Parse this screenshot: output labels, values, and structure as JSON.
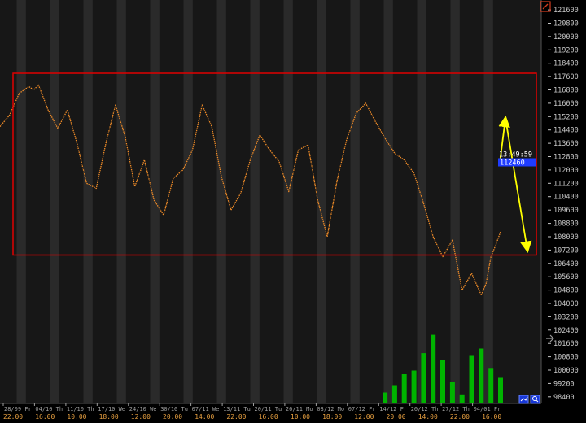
{
  "chart_data": {
    "type": "line",
    "title": "",
    "price_axis": {
      "ticks": [
        "121600",
        "120800",
        "120000",
        "119200",
        "118400",
        "117600",
        "116800",
        "116000",
        "115200",
        "114400",
        "113600",
        "112800",
        "112000",
        "111200",
        "110400",
        "109600",
        "108800",
        "108000",
        "107200",
        "106400",
        "105600",
        "104800",
        "104000",
        "103200",
        "102400",
        "101600",
        "100800",
        "100000",
        "99200",
        "98400"
      ],
      "ylim": [
        98000,
        121800
      ]
    },
    "price_marker": {
      "time": "13:49:59",
      "value": "112460"
    },
    "date_labels": [
      "28/09 Fr",
      "04/10 Th",
      "11/10 Th",
      "17/10 We",
      "24/10 We",
      "30/10 Tu",
      "07/11 We",
      "13/11 Tu",
      "20/11 Tu",
      "26/11 Mo",
      "03/12 Mo",
      "07/12 Fr",
      "14/12 Fr",
      "20/12 Th",
      "27/12 Th",
      "04/01 Fr"
    ],
    "time_labels": [
      "22:00",
      "16:00",
      "10:00",
      "18:00",
      "12:00",
      "20:00",
      "14:00",
      "22:00",
      "16:00",
      "10:00",
      "18:00",
      "12:00",
      "20:00",
      "14:00",
      "22:00",
      "16:00"
    ],
    "series": [
      {
        "color": "#f08c28",
        "x": [
          0,
          2,
          4,
          6,
          7,
          8,
          10,
          12,
          14,
          16,
          18,
          20,
          22,
          24,
          26,
          28,
          30,
          32,
          34,
          36,
          38,
          40,
          42,
          44,
          46,
          48,
          50,
          52,
          54,
          56,
          58,
          60,
          62,
          64,
          66,
          68,
          70,
          72,
          74,
          76,
          78,
          80,
          82,
          84,
          86,
          88,
          90,
          92,
          94,
          96,
          98,
          100
        ],
        "y": [
          114600,
          115300,
          116600,
          117000,
          116800,
          117100,
          115600,
          114500,
          115600,
          113600,
          111200,
          110900,
          113600,
          115900,
          114000,
          111000,
          112600,
          110200,
          109300,
          111500,
          112000,
          113200,
          115900,
          114600,
          111600,
          109600,
          110600,
          112600,
          114100,
          113200,
          112500,
          110700,
          113200,
          113500,
          110200,
          108000,
          111300,
          113800,
          115400,
          116000,
          114900,
          113900,
          113000,
          112600,
          111800,
          110000,
          108000,
          106800,
          107800,
          104800,
          105800,
          104500
        ]
      },
      {
        "color": "#f08c28",
        "x": [
          100,
          101,
          102,
          103,
          104
        ],
        "y": [
          104500,
          105200,
          106800,
          107500,
          108300
        ]
      }
    ],
    "volume_series": {
      "color": "#00b400",
      "x": [
        80,
        82,
        84,
        86,
        88,
        90,
        92,
        94,
        96,
        98,
        100,
        102,
        104
      ],
      "values": [
        1200,
        2000,
        3200,
        3600,
        5500,
        7500,
        4800,
        2400,
        1000,
        5200,
        6000,
        3800,
        2800
      ]
    },
    "box": {
      "y_top": 117800,
      "y_bottom": 106900,
      "color": "#e00000"
    },
    "arrows": [
      {
        "from_value": 112400,
        "to_value": 115100,
        "color": "#ffff00"
      },
      {
        "from_value": 115100,
        "to_value": 107200,
        "color": "#ffff00"
      }
    ],
    "legend": null,
    "grid": false
  },
  "toolbar": {
    "top_icon": "pencil-icon",
    "bottom_left_icon": "chart-icon",
    "bottom_right_icon": "zoom-icon",
    "side_arrow_icon": "arrow-right-icon",
    "accent": "#d43c1e"
  },
  "colors": {
    "background": "#000000",
    "stripe_light": "#2a2a2a",
    "stripe_dark": "#171717",
    "axis_text": "#c8c8c8",
    "date_text": "#9e9e9e",
    "time_text": "#e8a040",
    "marker_bg": "#1f3cff",
    "marker_text": "#ffffff",
    "time_marker_text": "#ffffff"
  }
}
